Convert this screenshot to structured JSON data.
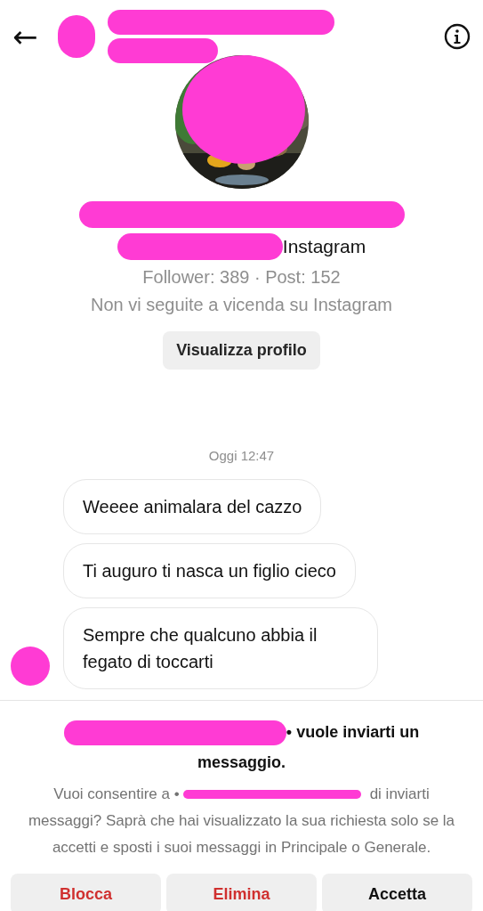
{
  "header": {
    "back": "←"
  },
  "profile": {
    "subtitle_suffix": "Instagram",
    "stats": "Follower: 389 · Post: 152",
    "relation": "Non vi seguite a vicenda su Instagram",
    "view_button": "Visualizza profilo"
  },
  "timestamp": "Oggi 12:47",
  "messages": [
    {
      "text": "Weeee animalara del cazzo",
      "avatar_shown": false
    },
    {
      "text": "Ti auguro ti nasca un figlio cieco",
      "avatar_shown": false
    },
    {
      "text": "Sempre che qualcuno abbia il fegato di toccarti",
      "avatar_shown": true
    }
  ],
  "request": {
    "title_suffix": "• vuole inviarti un messaggio.",
    "consent_before": "Vuoi consentire a •",
    "consent_after": "di inviarti",
    "consent_rest": "messaggi? Saprà che hai visualizzato la sua richiesta solo se la accetti e sposti i suoi messaggi in Principale o Generale."
  },
  "actions": [
    {
      "label": "Blocca",
      "kind": "danger"
    },
    {
      "label": "Elimina",
      "kind": "danger"
    },
    {
      "label": "Accetta",
      "kind": "normal"
    }
  ]
}
